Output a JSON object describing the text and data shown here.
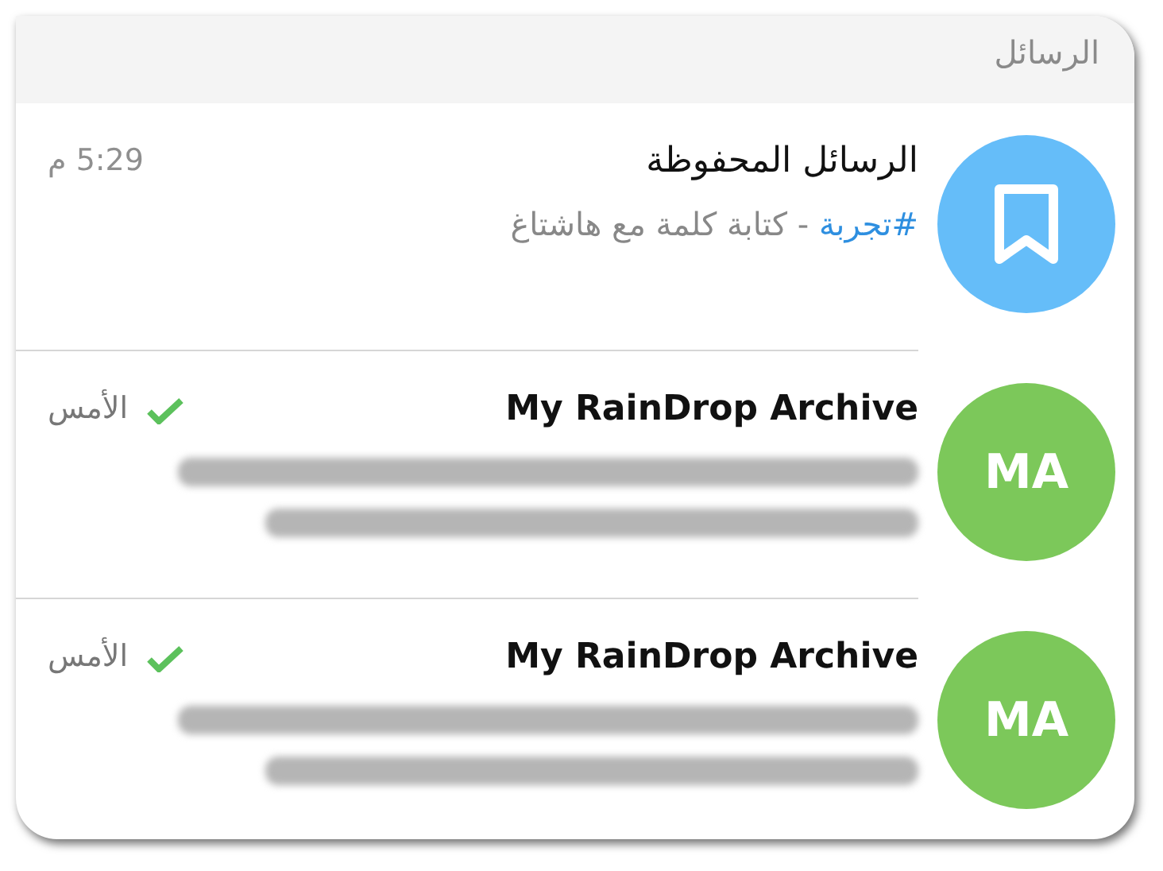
{
  "header": {
    "title": "الرسائل"
  },
  "chats": [
    {
      "kind": "saved",
      "title": "الرسائل المحفوظة",
      "time": "5:29 م",
      "blurred": false,
      "color": "#65bdf9",
      "preview": [
        {
          "kind": "hashtag",
          "text": "#تجربة"
        },
        {
          "kind": "plain",
          "text": " - كتابة كلمة مع هاشتاغ"
        }
      ]
    },
    {
      "kind": "initials",
      "initials": "MA",
      "title": "My RainDrop Archive",
      "time": "الأمس",
      "read": true,
      "blurred": true,
      "color": "#7cc85a"
    },
    {
      "kind": "initials",
      "initials": "MA",
      "title": "My RainDrop Archive",
      "time": "الأمس",
      "read": true,
      "blurred": true,
      "color": "#7cc85a"
    }
  ]
}
